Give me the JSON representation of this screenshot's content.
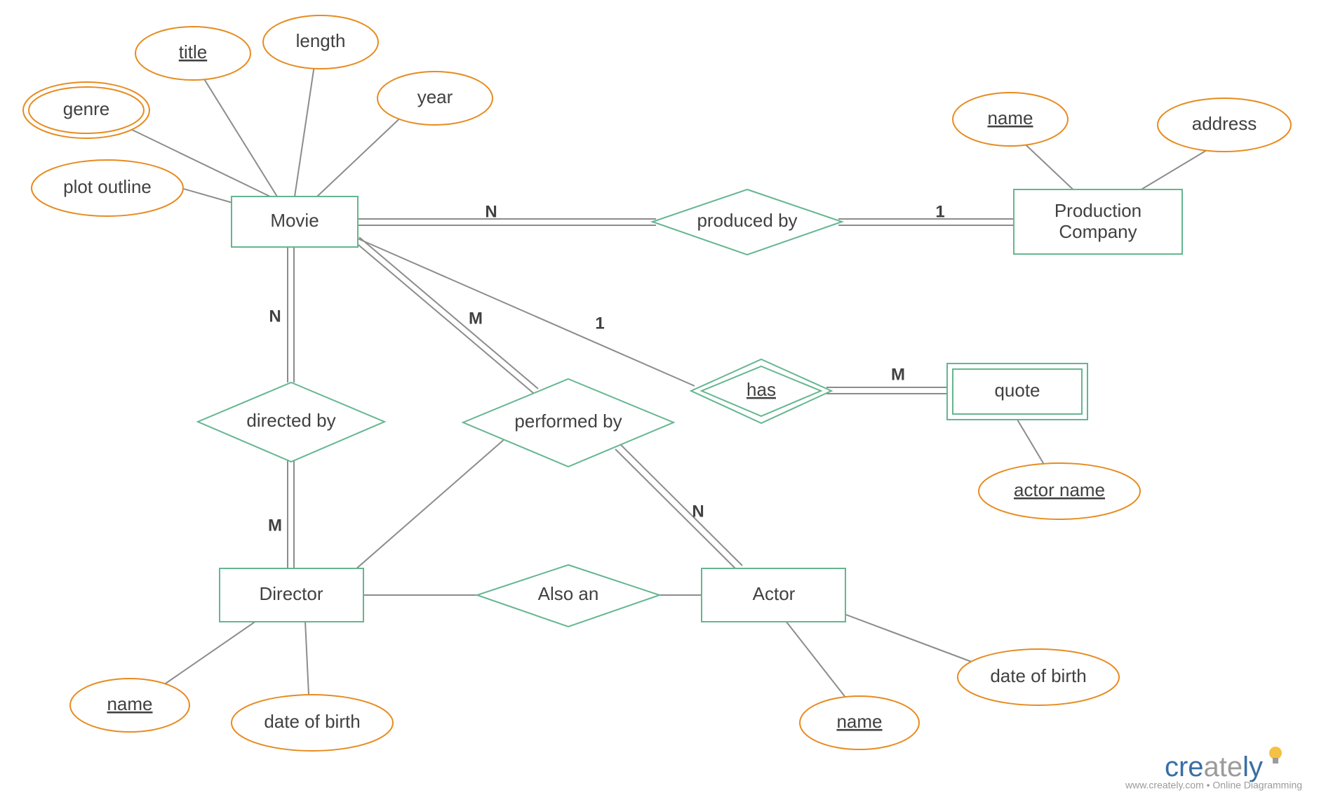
{
  "entities": {
    "movie": "Movie",
    "production_company_l1": "Production",
    "production_company_l2": "Company",
    "director": "Director",
    "actor": "Actor",
    "quote": "quote"
  },
  "relationships": {
    "produced_by": "produced by",
    "directed_by": "directed by",
    "performed_by": "performed by",
    "also_an": "Also an",
    "has": "has"
  },
  "attributes": {
    "genre": "genre",
    "title": "title",
    "length": "length",
    "year": "year",
    "plot_outline": "plot outline",
    "pc_name": "name",
    "pc_address": "address",
    "director_name": "name",
    "director_dob": "date of birth",
    "actor_name": "name",
    "actor_dob": "date of birth",
    "quote_actor_name": "actor name"
  },
  "cardinalities": {
    "movie_produced": "N",
    "pc_produced": "1",
    "movie_directed": "N",
    "director_directed": "M",
    "movie_performed": "M",
    "actor_performed": "N",
    "movie_has": "1",
    "quote_has": "M"
  },
  "branding": {
    "logo_cre": "cre",
    "logo_ate": "ate",
    "logo_ly": "ly",
    "tagline": "www.creately.com • Online Diagramming"
  }
}
